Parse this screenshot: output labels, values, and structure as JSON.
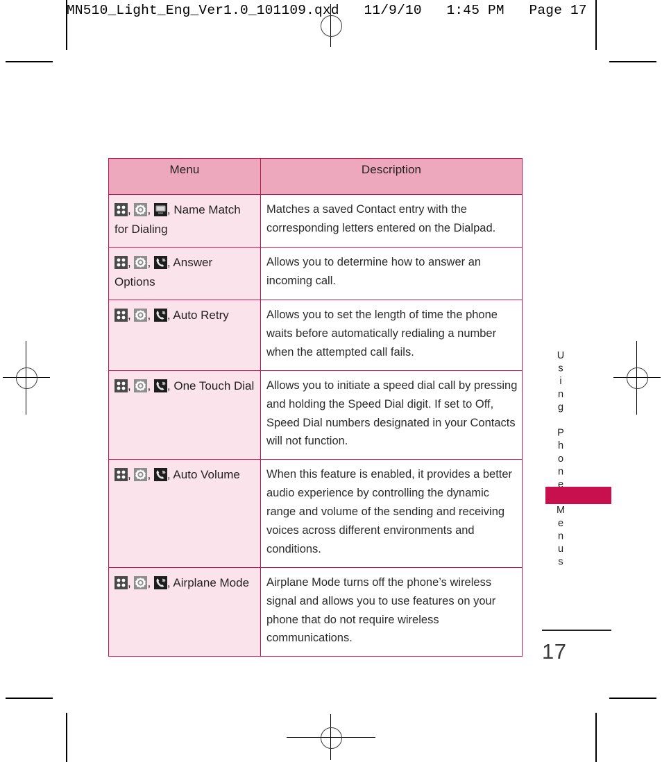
{
  "prepress": {
    "header": "MN510_Light_Eng_Ver1.0_101109.qxd   11/9/10   1:45 PM   Page 17"
  },
  "page": {
    "side_title": "Using Phone Menus",
    "folio": "17"
  },
  "colors": {
    "accent": "#c8104e",
    "header_fill": "#eda8bd",
    "menu_cell_fill": "#fae3ea",
    "text": "#231f20"
  },
  "table": {
    "headers": {
      "menu": "Menu",
      "description": "Description"
    },
    "rows": [
      {
        "icons": [
          "grid-menu-icon",
          "settings-gear-icon",
          "display-screen-icon"
        ],
        "menu_label": "Name Match for Dialing",
        "description": "Matches a saved Contact entry with the corresponding letters entered on the Dialpad."
      },
      {
        "icons": [
          "grid-menu-icon",
          "settings-gear-icon",
          "call-phone-icon"
        ],
        "menu_label": "Answer Options",
        "description": "Allows you to determine how to answer an incoming call."
      },
      {
        "icons": [
          "grid-menu-icon",
          "settings-gear-icon",
          "call-phone-icon"
        ],
        "menu_label": "Auto Retry",
        "description": "Allows you to set the length of time the phone waits before automatically redialing a number when the attempted call fails."
      },
      {
        "icons": [
          "grid-menu-icon",
          "settings-gear-icon",
          "call-phone-icon"
        ],
        "menu_label": "One Touch Dial",
        "description": "Allows you to initiate a speed dial call by pressing and holding the Speed Dial digit. If set to Off, Speed Dial numbers designated in your Contacts will not function."
      },
      {
        "icons": [
          "grid-menu-icon",
          "settings-gear-icon",
          "call-phone-icon"
        ],
        "menu_label": "Auto Volume",
        "description": "When this feature is enabled, it provides a better audio experience by controlling the dynamic range and volume of the sending and receiving voices across different environments and conditions."
      },
      {
        "icons": [
          "grid-menu-icon",
          "settings-gear-icon",
          "call-phone-icon"
        ],
        "menu_label": "Airplane Mode",
        "description": "Airplane Mode turns off the phone’s wireless signal and allows you to use features on your phone that do not require wireless communications."
      }
    ],
    "icon_separator": ", "
  }
}
